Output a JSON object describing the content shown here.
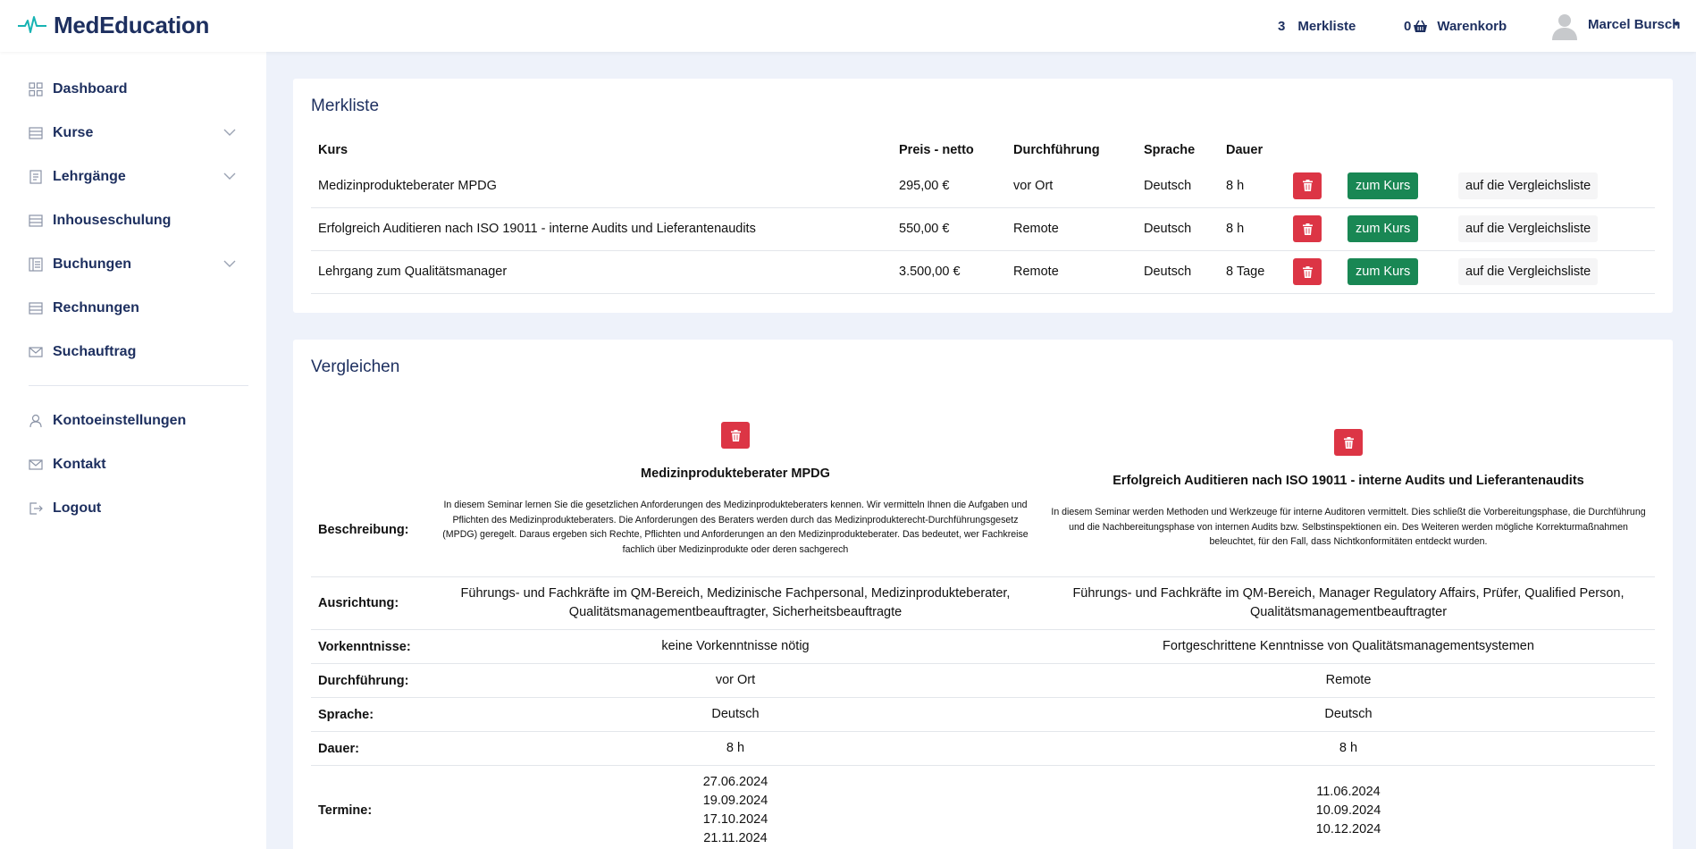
{
  "app": {
    "name": "MedEducation"
  },
  "topbar": {
    "merkliste_count": "3",
    "merkliste_label": "Merkliste",
    "cart_count": "0",
    "cart_label": "Warenkorb",
    "user_name": "Marcel Bursch"
  },
  "sidebar": {
    "items": [
      {
        "label": "Dashboard",
        "icon": "grid-icon"
      },
      {
        "label": "Kurse",
        "icon": "list-icon",
        "expandable": true
      },
      {
        "label": "Lehrgänge",
        "icon": "document-icon",
        "expandable": true
      },
      {
        "label": "Inhouseschulung",
        "icon": "list-icon"
      },
      {
        "label": "Buchungen",
        "icon": "ledger-icon",
        "expandable": true
      },
      {
        "label": "Rechnungen",
        "icon": "list-icon"
      },
      {
        "label": "Suchauftrag",
        "icon": "mail-icon"
      },
      {
        "label": "Kontoeinstellungen",
        "icon": "user-icon"
      },
      {
        "label": "Kontakt",
        "icon": "mail-icon"
      },
      {
        "label": "Logout",
        "icon": "logout-icon"
      }
    ]
  },
  "merkliste": {
    "title": "Merkliste",
    "columns": [
      "Kurs",
      "Preis - netto",
      "Durchführung",
      "Sprache",
      "Dauer"
    ],
    "rows": [
      {
        "kurs": "Medizinprodukteberater MPDG",
        "preis": "295,00 €",
        "durchfuehrung": "vor Ort",
        "sprache": "Deutsch",
        "dauer": "8 h"
      },
      {
        "kurs": "Erfolgreich Auditieren nach ISO 19011 - interne Audits und Lieferantenaudits",
        "preis": "550,00 €",
        "durchfuehrung": "Remote",
        "sprache": "Deutsch",
        "dauer": "8 h"
      },
      {
        "kurs": "Lehrgang zum Qualitätsmanager",
        "preis": "3.500,00 €",
        "durchfuehrung": "Remote",
        "sprache": "Deutsch",
        "dauer": "8 Tage"
      }
    ],
    "btn_course": "zum Kurs",
    "btn_compare": "auf die Vergleichsliste"
  },
  "vergleichen": {
    "title": "Vergleichen",
    "labels": {
      "beschreibung": "Beschreibung:",
      "ausrichtung": "Ausrichtung:",
      "vorkenntnisse": "Vorkenntnisse:",
      "durchfuehrung": "Durchführung:",
      "sprache": "Sprache:",
      "dauer": "Dauer:",
      "termine": "Termine:"
    },
    "courses": [
      {
        "title": "Medizinprodukteberater MPDG",
        "beschreibung": "In diesem Seminar lernen Sie die gesetzlichen Anforderungen des Medizinprodukteberaters kennen. Wir vermitteln Ihnen die Aufgaben und Pflichten des Medizinprodukteberaters. Die Anforderungen des Beraters werden durch das Medizinprodukterecht-Durchführungsgesetz (MPDG) geregelt. Daraus ergeben sich Rechte, Pflichten und Anforderungen an den Medizinprodukteberater. Das bedeutet, wer Fachkreise fachlich über Medizinprodukte oder deren sachgerech",
        "ausrichtung": "Führungs- und Fachkräfte im QM-Bereich, Medizinische Fachpersonal, Medizinprodukteberater, Qualitätsmanagementbeauftragter, Sicherheitsbeauftragte",
        "vorkenntnisse": "keine Vorkenntnisse nötig",
        "durchfuehrung": "vor Ort",
        "sprache": "Deutsch",
        "dauer": "8 h",
        "termine": [
          "27.06.2024",
          "19.09.2024",
          "17.10.2024",
          "21.11.2024"
        ]
      },
      {
        "title": "Erfolgreich Auditieren nach ISO 19011 - interne Audits und Lieferantenaudits",
        "beschreibung": "In diesem Seminar werden Methoden und Werkzeuge für interne Auditoren vermittelt. Dies schließt die Vorbereitungsphase, die Durchführung und die Nachbereitungsphase von internen Audits bzw. Selbstinspektionen ein. Des Weiteren werden mögliche Korrekturmaßnahmen beleuchtet, für den Fall, dass Nichtkonformitäten entdeckt wurden.",
        "ausrichtung": "Führungs- und Fachkräfte im QM-Bereich, Manager Regulatory Affairs, Prüfer, Qualified Person, Qualitätsmanagementbeauftragter",
        "vorkenntnisse": "Fortgeschrittene Kenntnisse von Qualitätsmanagementsystemen",
        "durchfuehrung": "Remote",
        "sprache": "Deutsch",
        "dauer": "8 h",
        "termine": [
          "11.06.2024",
          "10.09.2024",
          "10.12.2024"
        ]
      }
    ]
  },
  "colors": {
    "brand": "#1d2f5f",
    "accent": "#17b3b3",
    "danger": "#dc3545",
    "success": "#198754"
  }
}
